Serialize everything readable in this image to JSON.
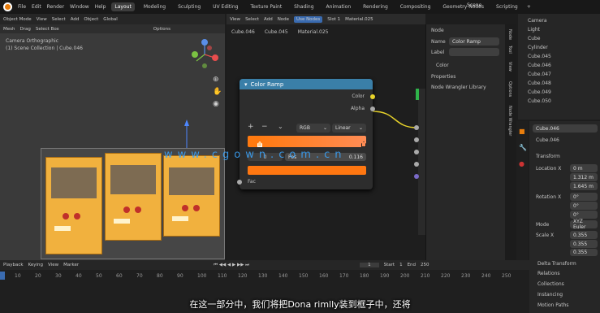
{
  "menu": [
    "File",
    "Edit",
    "Render",
    "Window",
    "Help"
  ],
  "workspaces": [
    "Layout",
    "Modeling",
    "Sculpting",
    "UV Editing",
    "Texture Paint",
    "Shading",
    "Animation",
    "Rendering",
    "Compositing",
    "Geometry Nodes",
    "Scripting"
  ],
  "active_workspace": "Layout",
  "scene_label": "Scene",
  "viewport": {
    "header": [
      "Object Mode",
      "View",
      "Select",
      "Add",
      "Object",
      "Global"
    ],
    "camera_title": "Camera Orthographic",
    "collection_path": "(1) Scene Collection | Cube.046",
    "options_label": "Options",
    "subheader": [
      "Mesh",
      "Drag",
      "Select Box"
    ]
  },
  "node_editor": {
    "header": [
      "View",
      "Select",
      "Add",
      "Node",
      "Use Nodes",
      "Slot 1",
      "Material.025"
    ],
    "breadcrumb": [
      "Cube.046",
      "Cube.045",
      "Material.025"
    ]
  },
  "color_ramp": {
    "title": "Color Ramp",
    "out_color": "Color",
    "out_alpha": "Alpha",
    "add": "+",
    "remove": "−",
    "menu": "⌄",
    "color_mode": "RGB",
    "interpolation": "Linear",
    "index": "0",
    "pos_label": "Pos",
    "pos_value": "0.116",
    "input_label": "Fac",
    "ramp_start": "#ff7a10",
    "ramp_end": "#ff8c55",
    "swatch": "#ff7711"
  },
  "n_panel": {
    "section_node": "Node",
    "name_label": "Name",
    "name_value": "Color Ramp",
    "label_label": "Label",
    "label_value": "",
    "color_label": "Color",
    "properties_label": "Properties",
    "custom_props": "Node Wrangler Library",
    "tabs": [
      "Node",
      "Tool",
      "View",
      "Options",
      "Node Wrangler"
    ]
  },
  "outliner": {
    "items": [
      "Camera",
      "Light",
      "Cube",
      "Cylinder",
      "Cube.045",
      "Cube.046",
      "Cube.047",
      "Cube.048",
      "Cube.049",
      "Cube.050"
    ]
  },
  "properties": {
    "object_name": "Cube.046",
    "search_value": "Cube.046",
    "transform": "Transform",
    "loc_label": "Location X",
    "loc": [
      "0 m",
      "1.312 m",
      "1.645 m"
    ],
    "rot_label": "Rotation X",
    "rot": [
      "0°",
      "0°",
      "0°"
    ],
    "mode_label": "Mode",
    "mode_value": "XYZ Euler",
    "scale_label": "Scale X",
    "scale": [
      "0.355",
      "0.355",
      "0.355"
    ],
    "sections": [
      "Delta Transform",
      "Relations",
      "Collections",
      "Instancing",
      "Motion Paths"
    ]
  },
  "timeline": {
    "header": [
      "Playback",
      "Keying",
      "View",
      "Marker"
    ],
    "frame": "1",
    "start_label": "Start",
    "start": "1",
    "end_label": "End",
    "end": "250",
    "ticks": [
      "10",
      "20",
      "30",
      "40",
      "50",
      "60",
      "70",
      "80",
      "90",
      "100",
      "110",
      "120",
      "130",
      "140",
      "150",
      "160",
      "170",
      "180",
      "190",
      "200",
      "210",
      "220",
      "230",
      "240",
      "250"
    ]
  },
  "watermark": "www.cgown.com.cn",
  "subtitle": "在这一部分中，我们将把Dona rimlly装到框子中，还将"
}
